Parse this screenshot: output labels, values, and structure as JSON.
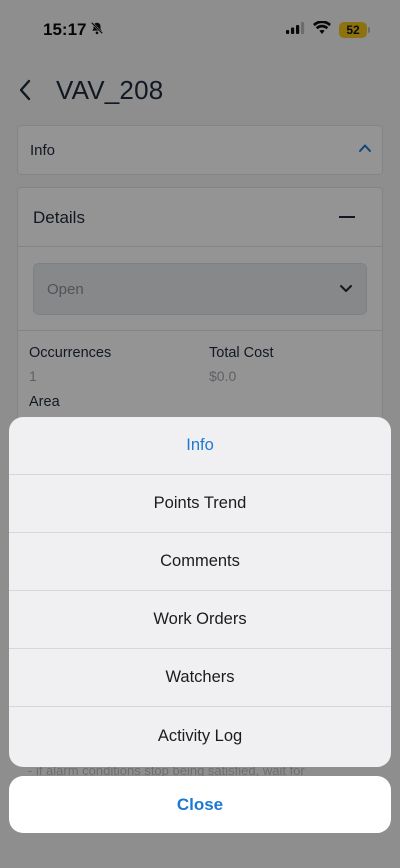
{
  "status_bar": {
    "time": "15:17",
    "battery_level": "52",
    "icons": [
      "bell-slash-icon",
      "signal-icon",
      "wifi-icon",
      "battery-icon"
    ]
  },
  "header": {
    "title": "VAV_208",
    "back_icon": "chevron-left-icon"
  },
  "info_section": {
    "label": "Info",
    "icon": "chevron-up-icon"
  },
  "details_section": {
    "label": "Details",
    "collapse_icon": "minus-icon",
    "status_select": {
      "value": "Open",
      "icon": "chevron-down-icon"
    },
    "fields": {
      "occurrences_label": "Occurrences",
      "occurrences_value": "1",
      "total_cost_label": "Total Cost",
      "total_cost_value": "$0.0",
      "area_label": "Area"
    }
  },
  "background_text": "- if alarm conditions stop being satisfied, wait for",
  "action_sheet": {
    "items": [
      {
        "label": "Info",
        "selected": true
      },
      {
        "label": "Points Trend",
        "selected": false
      },
      {
        "label": "Comments",
        "selected": false
      },
      {
        "label": "Work Orders",
        "selected": false
      },
      {
        "label": "Watchers",
        "selected": false
      },
      {
        "label": "Activity Log",
        "selected": false
      }
    ],
    "close_label": "Close"
  },
  "colors": {
    "accent": "#1d78d2",
    "battery": "#f5c518",
    "text": "#1f2a3a"
  }
}
